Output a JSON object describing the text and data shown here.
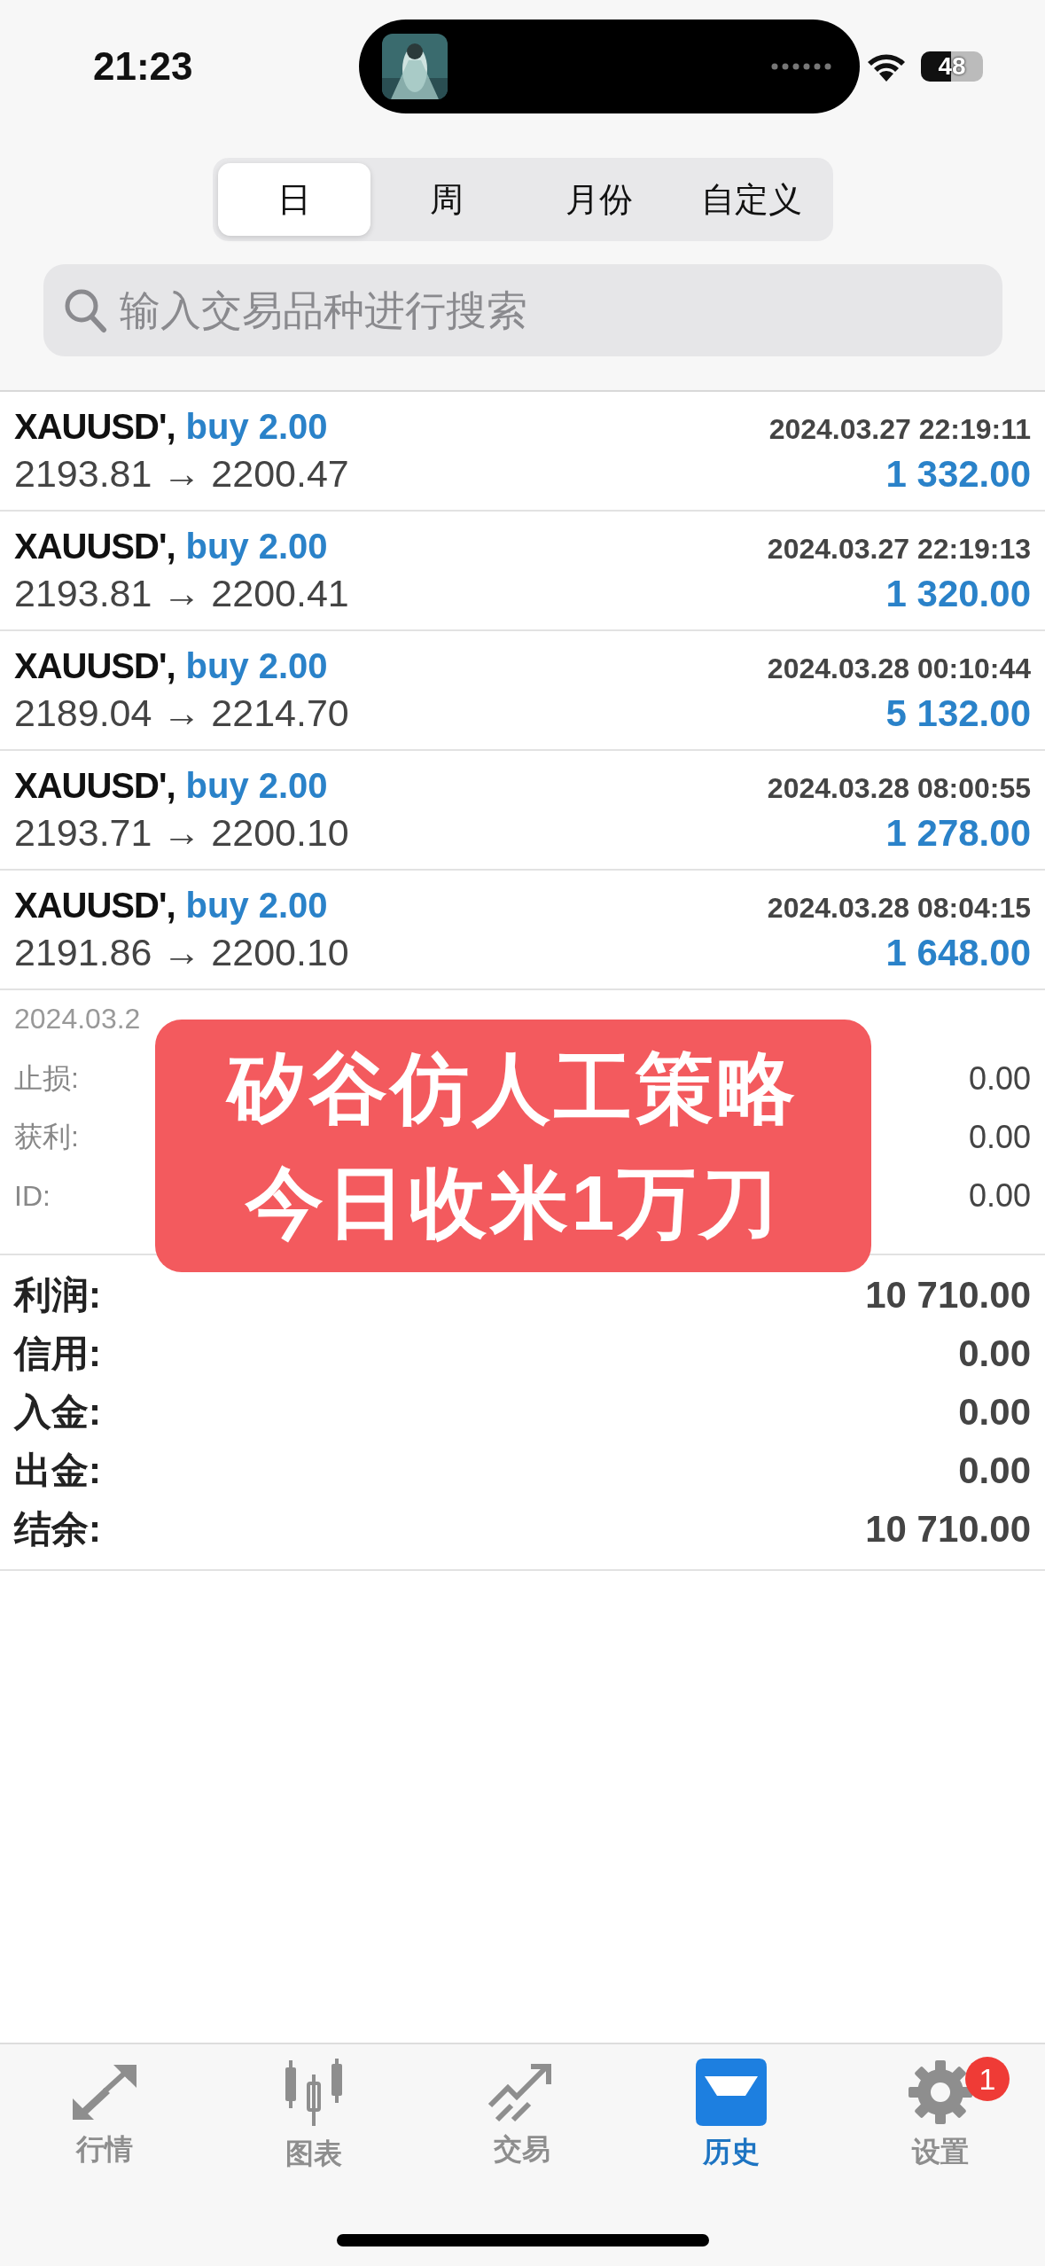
{
  "status_bar": {
    "time": "21:23",
    "battery": "48"
  },
  "period_tabs": [
    {
      "label": "日",
      "selected": true
    },
    {
      "label": "周",
      "selected": false
    },
    {
      "label": "月份",
      "selected": false
    },
    {
      "label": "自定义",
      "selected": false
    }
  ],
  "search": {
    "placeholder": "输入交易品种进行搜索"
  },
  "deals": [
    {
      "symbol": "XAUUSD',",
      "side": "buy 2.00",
      "time": "2024.03.27 22:19:11",
      "prices": "2193.81 → 2200.47",
      "profit": "1 332.00"
    },
    {
      "symbol": "XAUUSD',",
      "side": "buy 2.00",
      "time": "2024.03.27 22:19:13",
      "prices": "2193.81 → 2200.41",
      "profit": "1 320.00"
    },
    {
      "symbol": "XAUUSD',",
      "side": "buy 2.00",
      "time": "2024.03.28 00:10:44",
      "prices": "2189.04 → 2214.70",
      "profit": "5 132.00"
    },
    {
      "symbol": "XAUUSD',",
      "side": "buy 2.00",
      "time": "2024.03.28 08:00:55",
      "prices": "2193.71 → 2200.10",
      "profit": "1 278.00"
    },
    {
      "symbol": "XAUUSD',",
      "side": "buy 2.00",
      "time": "2024.03.28 08:04:15",
      "prices": "2191.86 → 2200.10",
      "profit": "1 648.00"
    }
  ],
  "details": {
    "comment": "2024.03.2",
    "fields": [
      {
        "label": "止损:",
        "value": "0.00"
      },
      {
        "label": "获利:",
        "value": "0.00"
      },
      {
        "label": "ID:",
        "value": "0.00"
      }
    ]
  },
  "overlay_banner": {
    "lines": [
      "矽谷仿人工策略",
      "今日收米1万刀"
    ]
  },
  "summary": [
    {
      "label": "利润:",
      "value": "10 710.00"
    },
    {
      "label": "信用:",
      "value": "0.00"
    },
    {
      "label": "入金:",
      "value": "0.00"
    },
    {
      "label": "出金:",
      "value": "0.00"
    },
    {
      "label": "结余:",
      "value": "10 710.00"
    }
  ],
  "tab_bar": [
    {
      "kind": "quotes",
      "label": "行情",
      "selected": false
    },
    {
      "kind": "chart",
      "label": "图表",
      "selected": false
    },
    {
      "kind": "trade",
      "label": "交易",
      "selected": false
    },
    {
      "kind": "history",
      "label": "历史",
      "selected": true
    },
    {
      "kind": "settings",
      "label": "设置",
      "selected": false,
      "badge": "1"
    }
  ]
}
